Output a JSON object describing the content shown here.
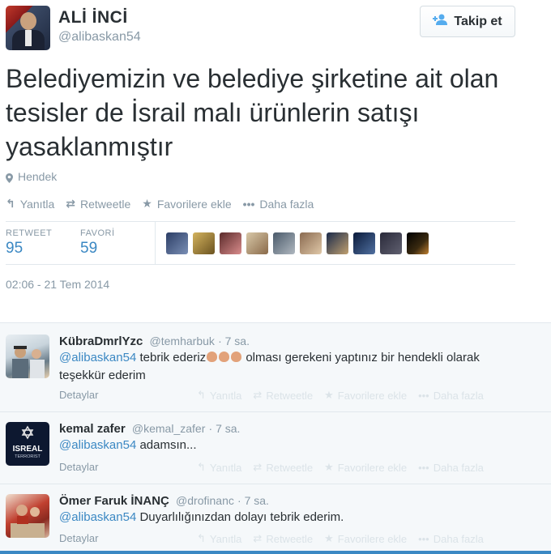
{
  "author": {
    "name": "ALİ İNCİ",
    "handle": "@alibaskan54"
  },
  "follow_label": "Takip et",
  "tweet_text": "Belediyemizin ve belediye şirketine ait olan tesisler de İsrail malı ürünlerin satışı yasaklanmıştır",
  "location": "Hendek",
  "actions": {
    "reply": "Yanıtla",
    "retweet": "Retweetle",
    "favorite": "Favorilere ekle",
    "more": "Daha fazla"
  },
  "stats": {
    "retweet_label": "RETWEET",
    "retweet_count": "95",
    "favori_label": "FAVORİ",
    "favori_count": "59"
  },
  "timestamp": "02:06 - 21 Tem 2014",
  "replies": [
    {
      "name": "KübraDmrlYzc",
      "handle": "@temharbuk",
      "time": "· 7 sa.",
      "mention": "@alibaskan54",
      "text_a": " tebrik ederiz",
      "text_b": " olması gerekeni yaptınız bir hendekli olarak teşekkür ederim",
      "detail": "Detaylar"
    },
    {
      "name": "kemal zafer",
      "handle": "@kemal_zafer",
      "time": "· 7 sa.",
      "mention": "@alibaskan54",
      "text_a": " adamsın...",
      "detail": "Detaylar",
      "avatar_text_1": "ISREAL",
      "avatar_text_2": "TERRORIST"
    },
    {
      "name": "Ömer Faruk İNANÇ",
      "handle": "@drofinanc",
      "time": "· 7 sa.",
      "mention": "@alibaskan54",
      "text_a": " Duyarlılığınızdan dolayı tebrik ederim.",
      "detail": "Detaylar"
    }
  ],
  "colors": {
    "link": "#3b88c3",
    "muted": "#8899a6",
    "accent": "#55acee"
  }
}
